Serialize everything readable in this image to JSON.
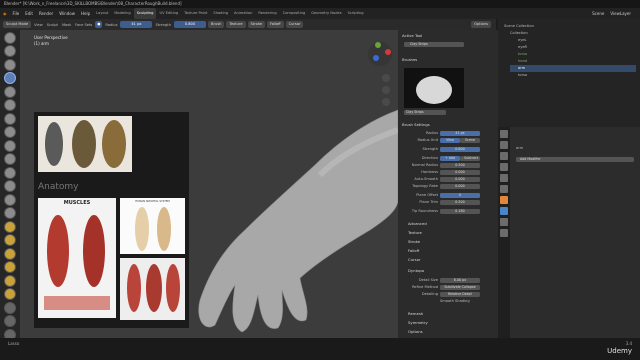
{
  "titlebar": {
    "text": "Blender* [K:\\Work_n_Freelance\\3D_SKILLBOMBS\\Blender\\08_CharacterRoughBuild.blend]"
  },
  "menu": [
    "File",
    "Edit",
    "Render",
    "Window",
    "Help"
  ],
  "workspaces": [
    "Layout",
    "Modeling",
    "Sculpting",
    "UV Editing",
    "Texture Paint",
    "Shading",
    "Animation",
    "Rendering",
    "Compositing",
    "Geometry Nodes",
    "Scripting"
  ],
  "active_workspace": "Sculpting",
  "scene": {
    "label": "Scene",
    "view_layer": "ViewLayer"
  },
  "header": {
    "mode": "Sculpt Mode",
    "items": [
      "View",
      "Sculpt",
      "Mask",
      "Face Sets"
    ],
    "radius_label": "Radius",
    "radius_value": "41 px",
    "strength_label": "Strength",
    "strength_value": "0.800",
    "buttons": [
      "Brush",
      "Texture",
      "Stroke",
      "Falloff",
      "Cursor"
    ],
    "options": "Options"
  },
  "viewport": {
    "perspective": "User Perspective",
    "object": "(1) arm"
  },
  "reference": {
    "heading": "Anatomy",
    "muscles_title": "MUSCLES",
    "skeleton_title": "HUMAN SKELETAL SYSTEM"
  },
  "npanel": {
    "tabs": [
      "Tool",
      "View"
    ],
    "active_tool": "Active Tool",
    "tool_name": "Clay Strips",
    "brushes_label": "Brushes",
    "brush_name": "Clay Strips",
    "brush_settings": "Brush Settings",
    "rows": [
      {
        "label": "Radius",
        "value": "41 px"
      },
      {
        "label": "Radius Unit",
        "value": "View",
        "value2": "Scene"
      },
      {
        "label": "Strength",
        "value": "0.800"
      },
      {
        "label": "Direction",
        "value": "+ Add",
        "value2": "- Subtract"
      },
      {
        "label": "Normal Radius",
        "value": "0.500"
      },
      {
        "label": "Hardness",
        "value": "0.000"
      },
      {
        "label": "Auto-Smooth",
        "value": "0.000"
      },
      {
        "label": "Topology Rake",
        "value": "0.000"
      },
      {
        "label": "Plane Offset",
        "value": "0"
      },
      {
        "label": "Plane Trim",
        "value": "0.500"
      },
      {
        "label": "Tip Roundness",
        "value": "0.180"
      }
    ],
    "sections": [
      "Advanced",
      "Texture",
      "Stroke",
      "Falloff",
      "Cursor"
    ],
    "dyntopo": "Dyntopo",
    "dyntopo_rows": [
      {
        "label": "Detail Size",
        "value": "8.00 px"
      },
      {
        "label": "Refine Method",
        "value": "Subdivide Collapse"
      },
      {
        "label": "Detailing",
        "value": "Relative Detail"
      }
    ],
    "smooth_shading": "Smooth Shading",
    "bottom_sections": [
      "Remesh",
      "Symmetry",
      "Options"
    ]
  },
  "outliner": {
    "title": "Scene Collection",
    "items": [
      {
        "name": "Collection",
        "selected": false
      },
      {
        "name": "eyeL",
        "selected": false
      },
      {
        "name": "eyeR",
        "selected": false
      },
      {
        "name": "torso",
        "selected": false
      },
      {
        "name": "head",
        "selected": false
      },
      {
        "name": "arm",
        "selected": true
      },
      {
        "name": "torso",
        "selected": false
      }
    ]
  },
  "properties": {
    "object": "arm",
    "add_modifier": "Add Modifier"
  },
  "status": {
    "left": "Lasso",
    "right": "3.4"
  },
  "watermark": "Udemy"
}
